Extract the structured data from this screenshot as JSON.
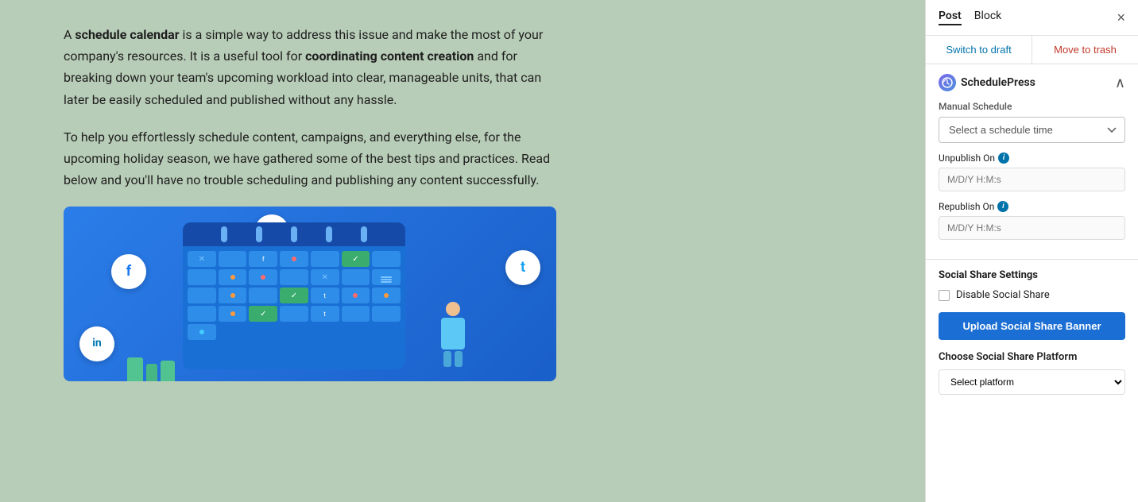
{
  "main": {
    "paragraph1_part1": "A ",
    "paragraph1_bold1": "schedule calendar",
    "paragraph1_part2": " is a simple way to address this issue and make the most of your company's resources. It is a useful tool for ",
    "paragraph1_bold2": "coordinating content creation",
    "paragraph1_part3": " and for breaking down your team's upcoming workload into clear, manageable units, that can later be easily scheduled and published without any hassle.",
    "paragraph2": "To help you effortlessly schedule content, campaigns, and everything else, for the upcoming holiday season, we have gathered some of the best tips and practices. Read below and you'll have no trouble scheduling and publishing any content successfully."
  },
  "sidebar": {
    "tabs": {
      "post": "Post",
      "block": "Block"
    },
    "close_icon": "×",
    "switch_to_draft": "Switch to draft",
    "move_to_trash": "Move to trash",
    "plugin_name": "SchedulePress",
    "collapse_icon": "∧",
    "manual_schedule_label": "Manual Schedule",
    "schedule_select_placeholder": "Select a schedule time",
    "unpublish_on_label": "Unpublish On",
    "unpublish_placeholder": "M/D/Y H:M:s",
    "republish_on_label": "Republish On",
    "republish_placeholder": "M/D/Y H:M:s",
    "social_share_settings": "Social Share Settings",
    "disable_social_share": "Disable Social Share",
    "upload_banner_btn": "Upload Social Share Banner",
    "choose_platform_label": "Choose Social Share Platform"
  }
}
